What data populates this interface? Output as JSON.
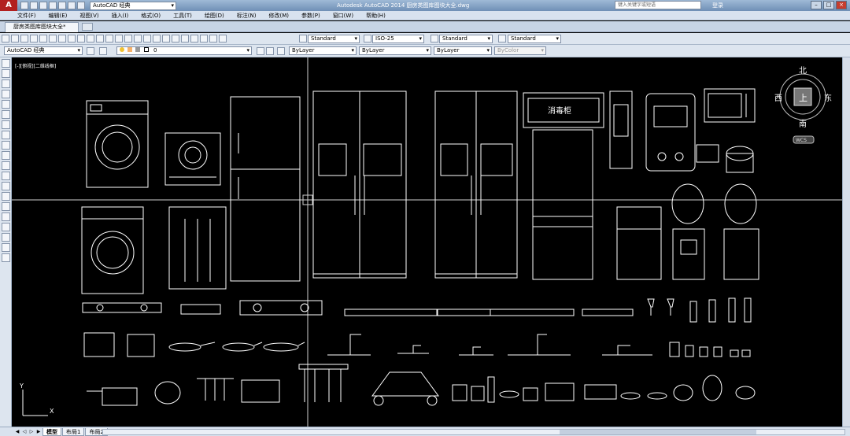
{
  "app": {
    "logo_letter": "A",
    "workspace": "AutoCAD 经典",
    "window_title": "Autodesk AutoCAD 2014    厨房类图库图块大全.dwg",
    "search_placeholder": "键入关键字或短语",
    "login": "登录"
  },
  "menu": [
    "文件(F)",
    "编辑(E)",
    "视图(V)",
    "插入(I)",
    "格式(O)",
    "工具(T)",
    "绘图(D)",
    "标注(N)",
    "修改(M)",
    "参数(P)",
    "窗口(W)",
    "帮助(H)"
  ],
  "doc_tab": "厨房类图库图块大全*",
  "styles": {
    "text_style": "Standard",
    "dim_style": "ISO-25",
    "table_style": "Standard",
    "mleader_style": "Standard"
  },
  "layers": {
    "workspace": "AutoCAD 经典",
    "current_layer": "0",
    "color": "ByLayer",
    "linetype": "ByLayer",
    "lineweight": "ByLayer",
    "plotstyle": "ByColor"
  },
  "viewport_label": "[-][俯视][二维线框]",
  "viewcube": {
    "north": "北",
    "south": "南",
    "east": "东",
    "west": "西",
    "top_face": "上",
    "wcs": "WCS"
  },
  "drawing": {
    "cabinet_label": "消毒柜"
  },
  "ucs": {
    "y": "Y",
    "x": "X"
  },
  "layout_tabs": [
    "模型",
    "布局1",
    "布局2"
  ],
  "colors": {
    "accent": "#b21f1f",
    "canvas": "#000000",
    "lines": "#ffffff"
  }
}
